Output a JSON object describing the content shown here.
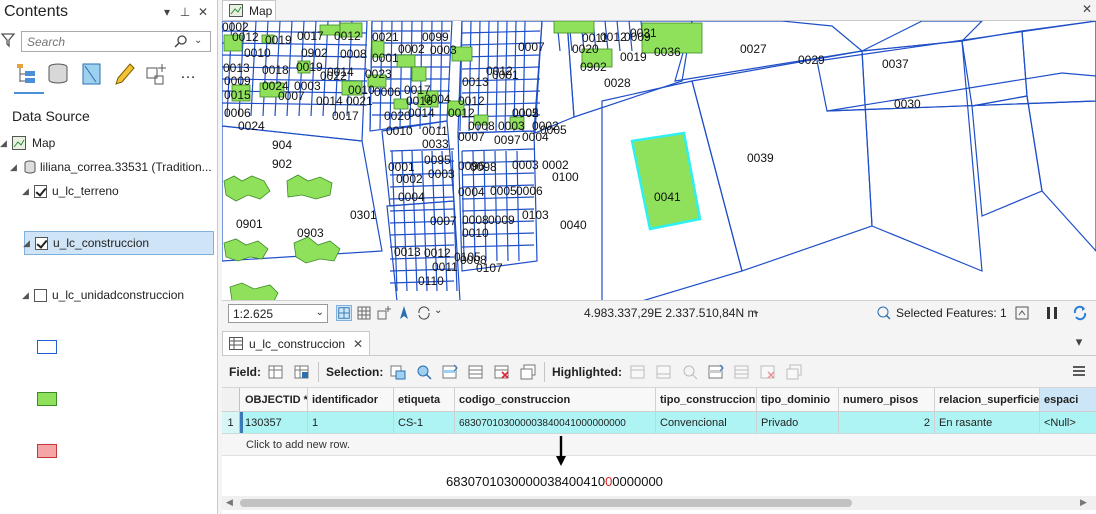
{
  "contents": {
    "title": "Contents",
    "search_placeholder": "Search",
    "data_source_label": "Data Source",
    "tree": {
      "map": "Map",
      "database": "liliana_correa.33531 (Tradition...",
      "layers": [
        {
          "name": "u_lc_terreno",
          "checked": true,
          "swatch_fill": "#ffffff",
          "swatch_stroke": "#1f5fd0"
        },
        {
          "name": "u_lc_construccion",
          "checked": true,
          "swatch_fill": "#8fe05a",
          "swatch_stroke": "#3c8a2a"
        },
        {
          "name": "u_lc_unidadconstruccion",
          "checked": false,
          "swatch_fill": "#f4a6a6",
          "swatch_stroke": "#c23b3b"
        }
      ]
    }
  },
  "map": {
    "tab_label": "Map",
    "parcel_labels": [
      "0012",
      "0019",
      "0017",
      "0012",
      "0021",
      "0099",
      "0010",
      "0902",
      "0008",
      "0001",
      "0002",
      "0003",
      "0013",
      "0019",
      "0014",
      "0023",
      "0018",
      "0022",
      "0009",
      "0024",
      "0003",
      "0010",
      "0006",
      "0017",
      "0015",
      "0007",
      "0014",
      "0021",
      "0016",
      "0012",
      "0004",
      "0013",
      "0012",
      "0006",
      "0017",
      "0020",
      "0014",
      "0012",
      "0005",
      "0024",
      "0010",
      "0011",
      "0008",
      "0003",
      "0002",
      "0007",
      "0097",
      "0004",
      "904",
      "902",
      "0033",
      "0095",
      "0096",
      "0001",
      "0002",
      "0003",
      "0098",
      "0003",
      "0002",
      "0100",
      "0004",
      "0004",
      "0005",
      "0006",
      "0103",
      "0007",
      "0008",
      "0009",
      "0010",
      "0013",
      "0011",
      "0012",
      "0105",
      "0107",
      "0110",
      "0008",
      "0901",
      "0903",
      "0301",
      "0040",
      "0041",
      "0039",
      "0027",
      "0029",
      "0037",
      "0030",
      "0028",
      "0036",
      "0902",
      "0019",
      "0020",
      "0011",
      "0012",
      "0009",
      "0031",
      "0007",
      "0001",
      "0002",
      "0005",
      "0002"
    ],
    "scale": "1:2.625",
    "coordinates": "4.983.337,29E 2.337.510,84N m",
    "selected_features": "Selected Features: 1"
  },
  "table": {
    "tab_label": "u_lc_construccion",
    "toolbar": {
      "field_label": "Field:",
      "selection_label": "Selection:",
      "highlighted_label": "Highlighted:"
    },
    "columns": [
      "OBJECTID *",
      "identificador",
      "etiqueta",
      "codigo_construccion",
      "tipo_construccion",
      "tipo_dominio",
      "numero_pisos",
      "relacion_superficie",
      "espaci"
    ],
    "rows": [
      {
        "rownum": "1",
        "cells": [
          "130357",
          "1",
          "CS-1",
          "683070103000003840041000000000",
          "Convencional",
          "Privado",
          "2",
          "En rasante",
          "<Null>"
        ]
      }
    ],
    "add_row_text": "Click to add new row.",
    "annotation": {
      "prefix": "6830701030000038400410",
      "highlight": "0",
      "suffix": "0000000"
    }
  }
}
